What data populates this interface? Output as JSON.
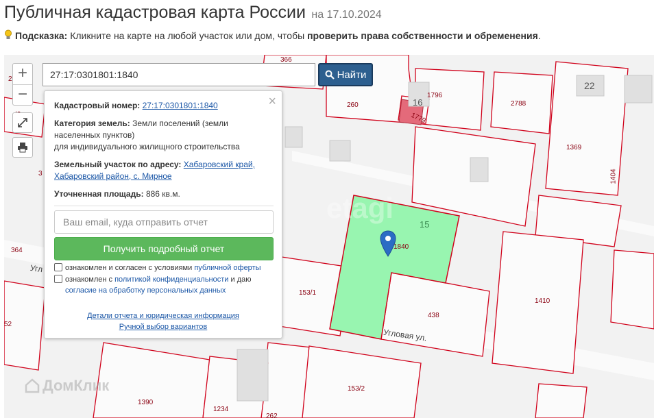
{
  "header": {
    "title": "Публичная кадастровая карта России",
    "date": "на 17.10.2024",
    "hint_label": "Подсказка:",
    "hint_text": "Кликните на карте на любой участок или дом, чтобы",
    "hint_bold": "проверить права собственности и обременения",
    "hint_end": "."
  },
  "search": {
    "value": "27:17:0301801:1840",
    "button_label": "Найти"
  },
  "popup": {
    "cad_label": "Кадастровый номер:",
    "cad_value": "27:17:0301801:1840",
    "cat_label": "Категория земель:",
    "cat_value": "Земли поселений (земли населенных пунктов)",
    "cat_use": "для индивидуального жилищного строительства",
    "addr_label": "Земельный участок по адресу:",
    "addr_value_1": "Хабаровский край,",
    "addr_value_2": "Хабаровский район, с. Мирное",
    "area_label": "Уточненная площадь:",
    "area_value": "886 кв.м.",
    "email_placeholder": "Ваш email, куда отправить отчет",
    "report_button": "Получить подробный отчет",
    "check1_text": "ознакомлен и согласен с условиями",
    "check1_link": "публичной оферты",
    "check2_text_a": "ознакомлен с",
    "check2_link_a": "политикой конфиденциальности",
    "check2_text_b": "и даю",
    "check2_link_b": "согласие на обработку персональных данных",
    "details_link": "Детали отчета и юридическая информация",
    "manual_link": "Ручной выбор вариантов"
  },
  "map": {
    "labels": [
      "366",
      "260",
      "1796",
      "1779",
      "2788",
      "22",
      "1369",
      "1404",
      "15",
      "1840",
      "153/1",
      "438",
      "1410",
      "Угловая ул.",
      "Угл",
      "364",
      "153/2",
      "1390",
      "1234",
      "262",
      "3",
      "2",
      "135",
      "52",
      "16"
    ],
    "watermark": "ДомКлик",
    "bg_watermark": "etagi"
  },
  "colors": {
    "boundary": "#d0021b",
    "selected_fill": "#98f5b0",
    "selected_stroke": "#d0021b",
    "marker": "#2b6cc4",
    "report_button": "#5cb85c",
    "search_button": "#2d5f8f"
  }
}
